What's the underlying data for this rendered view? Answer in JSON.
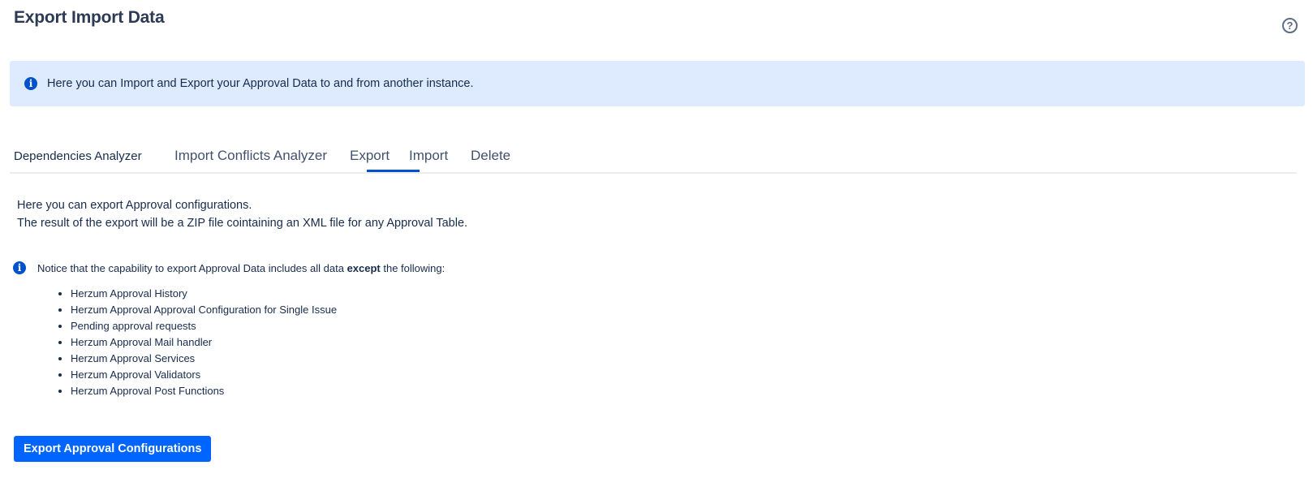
{
  "header": {
    "title": "Export Import Data",
    "help_icon": "question-circle-icon",
    "help_glyph": "?"
  },
  "banner": {
    "icon": "info-icon",
    "icon_glyph": "i",
    "text": "Here you can Import and Export your Approval Data to and from another instance."
  },
  "tabs": [
    {
      "label": "Dependencies Analyzer",
      "active": false
    },
    {
      "label": "Import Conflicts Analyzer",
      "active": false
    },
    {
      "label": "Export",
      "active": true
    },
    {
      "label": "Import",
      "active": false
    },
    {
      "label": "Delete",
      "active": false
    }
  ],
  "export": {
    "intro_line_1": "Here you can export Approval configurations.",
    "intro_line_2": "The result of the export will be a ZIP file cointaining an XML file for any Approval Table.",
    "notice_before": "Notice that the capability to export Approval Data includes all data ",
    "notice_bold": "except",
    "notice_after": " the following:",
    "exceptions": [
      "Herzum Approval History",
      "Herzum Approval Approval Configuration for Single Issue",
      "Pending approval requests",
      "Herzum Approval Mail handler",
      "Herzum Approval Services",
      "Herzum Approval Validators",
      "Herzum Approval Post Functions"
    ],
    "button_label": "Export Approval Configurations"
  },
  "colors": {
    "accent": "#0052cc",
    "button": "#0065ff",
    "banner_bg": "#deebff"
  }
}
